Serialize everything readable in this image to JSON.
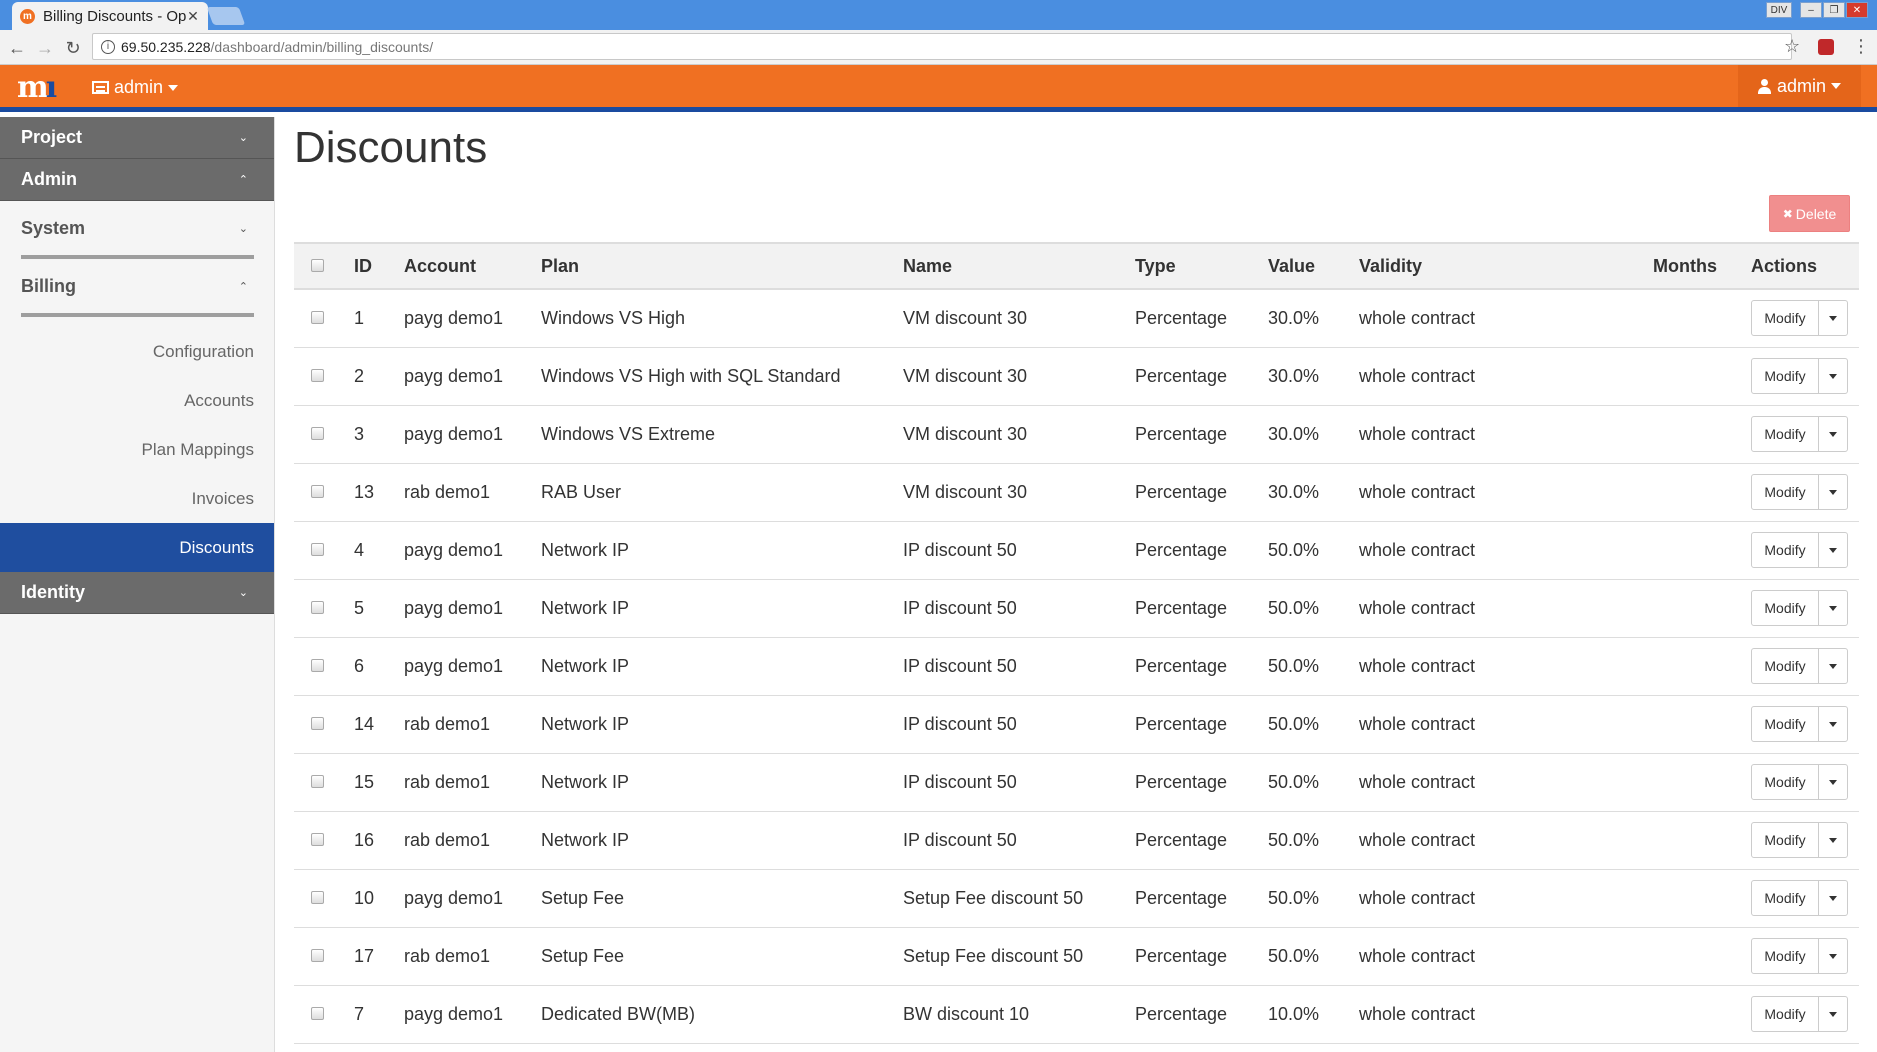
{
  "browser": {
    "tab_title": "Billing Discounts - Op",
    "tab_close": "✕",
    "url_host": "69.50.235.228",
    "url_path": "/dashboard/admin/billing_discounts/",
    "window_controls": [
      "DIV",
      "–",
      "❐",
      "✕"
    ]
  },
  "header": {
    "logo_text": "m",
    "logo_accent": "ı",
    "admin_menu_label": "admin",
    "user_menu_label": "admin",
    "brand_color": "#f07022",
    "accent_color": "#1a4ba0"
  },
  "sidebar": {
    "project_label": "Project",
    "admin_label": "Admin",
    "system_label": "System",
    "billing_label": "Billing",
    "billing_items": [
      "Configuration",
      "Accounts",
      "Plan Mappings",
      "Invoices",
      "Discounts"
    ],
    "active_item": "Discounts",
    "identity_label": "Identity",
    "chevron_down": "⌄",
    "chevron_up": "⌃"
  },
  "main": {
    "title": "Discounts",
    "delete_label": "Delete",
    "delete_icon": "✖"
  },
  "table": {
    "columns": [
      "ID",
      "Account",
      "Plan",
      "Name",
      "Type",
      "Value",
      "Validity",
      "Months",
      "Actions"
    ],
    "action_label": "Modify",
    "rows": [
      {
        "id": "1",
        "account": "payg demo1",
        "plan": "Windows VS High",
        "name": "VM discount 30",
        "type": "Percentage",
        "value": "30.0%",
        "validity": "whole contract",
        "months": ""
      },
      {
        "id": "2",
        "account": "payg demo1",
        "plan": "Windows VS High with SQL Standard",
        "name": "VM discount 30",
        "type": "Percentage",
        "value": "30.0%",
        "validity": "whole contract",
        "months": ""
      },
      {
        "id": "3",
        "account": "payg demo1",
        "plan": "Windows VS Extreme",
        "name": "VM discount 30",
        "type": "Percentage",
        "value": "30.0%",
        "validity": "whole contract",
        "months": ""
      },
      {
        "id": "13",
        "account": "rab demo1",
        "plan": "RAB User",
        "name": "VM discount 30",
        "type": "Percentage",
        "value": "30.0%",
        "validity": "whole contract",
        "months": ""
      },
      {
        "id": "4",
        "account": "payg demo1",
        "plan": "Network IP",
        "name": "IP discount 50",
        "type": "Percentage",
        "value": "50.0%",
        "validity": "whole contract",
        "months": ""
      },
      {
        "id": "5",
        "account": "payg demo1",
        "plan": "Network IP",
        "name": "IP discount 50",
        "type": "Percentage",
        "value": "50.0%",
        "validity": "whole contract",
        "months": ""
      },
      {
        "id": "6",
        "account": "payg demo1",
        "plan": "Network IP",
        "name": "IP discount 50",
        "type": "Percentage",
        "value": "50.0%",
        "validity": "whole contract",
        "months": ""
      },
      {
        "id": "14",
        "account": "rab demo1",
        "plan": "Network IP",
        "name": "IP discount 50",
        "type": "Percentage",
        "value": "50.0%",
        "validity": "whole contract",
        "months": ""
      },
      {
        "id": "15",
        "account": "rab demo1",
        "plan": "Network IP",
        "name": "IP discount 50",
        "type": "Percentage",
        "value": "50.0%",
        "validity": "whole contract",
        "months": ""
      },
      {
        "id": "16",
        "account": "rab demo1",
        "plan": "Network IP",
        "name": "IP discount 50",
        "type": "Percentage",
        "value": "50.0%",
        "validity": "whole contract",
        "months": ""
      },
      {
        "id": "10",
        "account": "payg demo1",
        "plan": "Setup Fee",
        "name": "Setup Fee discount 50",
        "type": "Percentage",
        "value": "50.0%",
        "validity": "whole contract",
        "months": ""
      },
      {
        "id": "17",
        "account": "rab demo1",
        "plan": "Setup Fee",
        "name": "Setup Fee discount 50",
        "type": "Percentage",
        "value": "50.0%",
        "validity": "whole contract",
        "months": ""
      },
      {
        "id": "7",
        "account": "payg demo1",
        "plan": "Dedicated BW(MB)",
        "name": "BW discount 10",
        "type": "Percentage",
        "value": "10.0%",
        "validity": "whole contract",
        "months": ""
      }
    ]
  }
}
